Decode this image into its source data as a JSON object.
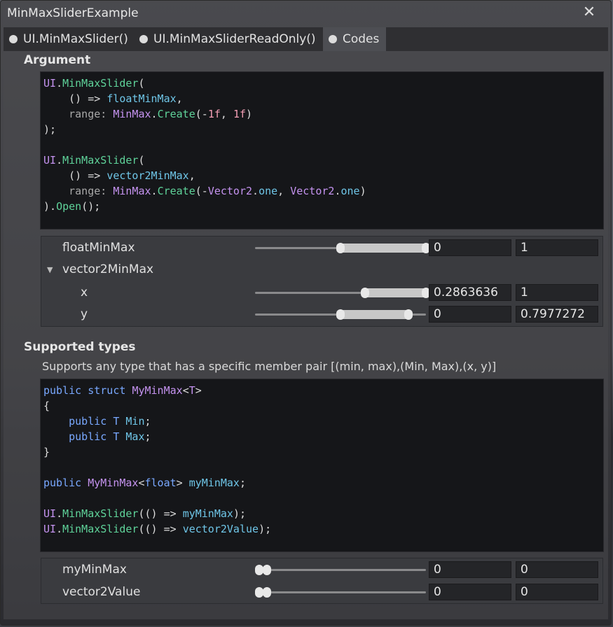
{
  "window": {
    "title": "MinMaxSliderExample"
  },
  "tabs": [
    {
      "label": "UI.MinMaxSlider()"
    },
    {
      "label": "UI.MinMaxSliderReadOnly()"
    },
    {
      "label": "Codes"
    }
  ],
  "argument": {
    "heading": "Argument",
    "code_lines": [
      "UI.MinMaxSlider(",
      "    () => floatMinMax,",
      "    range: MinMax.Create(-1f, 1f)",
      ");",
      "",
      "UI.MinMaxSlider(",
      "    () => vector2MinMax,",
      "    range: MinMax.Create(-Vector2.one, Vector2.one)",
      ").Open();"
    ],
    "rows": [
      {
        "label": "floatMinMax",
        "min": "0",
        "max": "1",
        "min_fraction": 0.5,
        "max_fraction": 1.0
      },
      {
        "label": "vector2MinMax"
      },
      {
        "label": "x",
        "min": "0.2863636",
        "max": "1",
        "min_fraction": 0.6431818,
        "max_fraction": 1.0
      },
      {
        "label": "y",
        "min": "0",
        "max": "0.7977272",
        "min_fraction": 0.5,
        "max_fraction": 0.8988636
      }
    ]
  },
  "supported": {
    "heading": "Supported types",
    "description": "Supports any type that has a specific member pair [(min, max),(Min, Max),(x, y)]",
    "code_lines": [
      "public struct MyMinMax<T>",
      "{",
      "    public T Min;",
      "    public T Max;",
      "}",
      "",
      "public MyMinMax<float> myMinMax;",
      "",
      "UI.MinMaxSlider(() => myMinMax);",
      "UI.MinMaxSlider(() => vector2Value);"
    ],
    "rows": [
      {
        "label": "myMinMax",
        "min": "0",
        "max": "0"
      },
      {
        "label": "vector2Value",
        "min": "0",
        "max": "0"
      }
    ]
  },
  "icons": {
    "close": "close-icon",
    "tab_dot": "radio-dot-icon",
    "foldout": "triangle-down-icon"
  },
  "colors": {
    "keyword": "#79a8ff",
    "class": "#c593f0",
    "method": "#5fd39a",
    "identifier": "#6fc6e8",
    "number": "#f49fb5"
  }
}
